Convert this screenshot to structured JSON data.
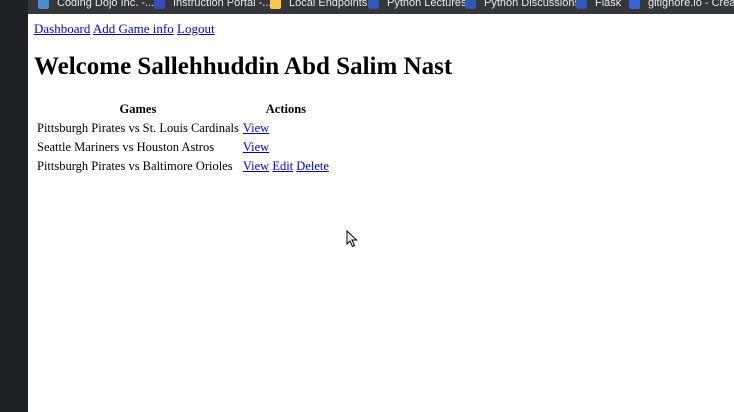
{
  "bookmarks": [
    {
      "label": "Coding Dojo Inc. -...",
      "icon": "bookmark-coding-dojo-icon",
      "color": "#4a8bd4"
    },
    {
      "label": "Instruction Portal -...",
      "icon": "bookmark-instruction-portal-icon",
      "color": "#3b4dbb"
    },
    {
      "label": "Local Endpoints",
      "icon": "folder-icon",
      "color": "#f6c945"
    },
    {
      "label": "Python Lectures",
      "icon": "bookmark-python-lectures-icon",
      "color": "#2f5bb7"
    },
    {
      "label": "Python Discussions",
      "icon": "bookmark-python-discussions-icon",
      "color": "#2f5bb7"
    },
    {
      "label": "Flask",
      "icon": "bookmark-flask-icon",
      "color": "#2f5bb7"
    },
    {
      "label": "gitignore.io - Creat...",
      "icon": "bookmark-gitignore-icon",
      "color": "#3b63d6"
    }
  ],
  "nav": {
    "dashboard": "Dashboard",
    "add_game": "Add Game info",
    "logout": "Logout"
  },
  "heading": "Welcome Sallehhuddin Abd Salim Nast",
  "table": {
    "headers": {
      "games": "Games",
      "actions": "Actions"
    },
    "rows": [
      {
        "game": "Pittsburgh Pirates vs St. Louis Cardinals",
        "view": "View",
        "edit": "",
        "delete": ""
      },
      {
        "game": "Seattle Mariners vs Houston Astros",
        "view": "View",
        "edit": "",
        "delete": ""
      },
      {
        "game": "Pittsburgh Pirates vs Baltimore Orioles",
        "view": "View",
        "edit": "Edit",
        "delete": "Delete"
      }
    ]
  },
  "colors": {
    "link": "#0000ee",
    "toolbar": "#35363a",
    "page": "#ffffff"
  }
}
